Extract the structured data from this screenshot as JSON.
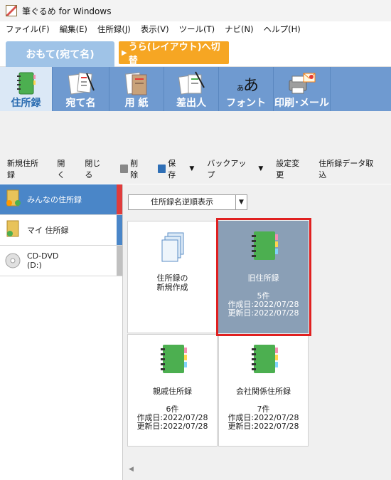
{
  "window": {
    "title": "筆ぐるめ for Windows"
  },
  "menu": [
    "ファイル(F)",
    "編集(E)",
    "住所録(J)",
    "表示(V)",
    "ツール(T)",
    "ナビ(N)",
    "ヘルプ(H)"
  ],
  "tabs": {
    "front": "おもて(宛て名)",
    "back": "うら(レイアウト)へ切替"
  },
  "toolbar": [
    {
      "label": "住所録",
      "icon": "address-book-icon"
    },
    {
      "label": "宛て名",
      "icon": "postcard-pen-icon"
    },
    {
      "label": "用 紙",
      "icon": "paper-icon"
    },
    {
      "label": "差出人",
      "icon": "sender-icon"
    },
    {
      "label": "フォント",
      "icon": "font-icon",
      "glyph": "ぁあ"
    },
    {
      "label": "印刷･メール",
      "icon": "printer-mail-icon"
    }
  ],
  "commands": {
    "new": "新規住所録",
    "open": "開く",
    "close": "閉じる",
    "delete": "削除",
    "save": "保存",
    "backup": "バックアップ",
    "settings": "設定変更",
    "import": "住所録データ取込"
  },
  "sidebar": [
    {
      "label": "みんなの住所録",
      "icon": "shared-folder-icon",
      "marker": "#e03c3c"
    },
    {
      "label": "マイ 住所録",
      "icon": "my-folder-icon",
      "marker": "#4a86c8"
    },
    {
      "label": "CD-DVD\n(D:)",
      "icon": "cd-dvd-icon",
      "marker": "#c0c0c0"
    }
  ],
  "sort": {
    "value": "住所録名逆順表示"
  },
  "cards": [
    {
      "name": "住所録の\n新規作成",
      "count": "",
      "created": "",
      "updated": "",
      "icon": "new-address-book-icon"
    },
    {
      "name": "旧住所録",
      "count": "5件",
      "created": "作成日:2022/07/28",
      "updated": "更新日:2022/07/28",
      "icon": "notebook-icon",
      "selected": true
    },
    {
      "name": "親戚住所録",
      "count": "6件",
      "created": "作成日:2022/07/28",
      "updated": "更新日:2022/07/28",
      "icon": "notebook-icon"
    },
    {
      "name": "会社関係住所録",
      "count": "7件",
      "created": "作成日:2022/07/28",
      "updated": "更新日:2022/07/28",
      "icon": "notebook-icon"
    }
  ]
}
